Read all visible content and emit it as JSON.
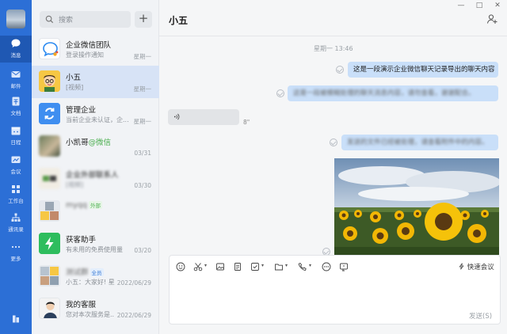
{
  "rail": {
    "items": [
      {
        "label": "消息",
        "icon": "chat-bubble-icon",
        "active": true
      },
      {
        "label": "邮件",
        "icon": "mail-icon"
      },
      {
        "label": "文档",
        "icon": "document-icon"
      },
      {
        "label": "日程",
        "icon": "calendar-icon"
      },
      {
        "label": "会议",
        "icon": "meeting-icon"
      },
      {
        "label": "工作台",
        "icon": "workbench-grid-icon"
      },
      {
        "label": "通讯录",
        "icon": "contacts-icon"
      },
      {
        "label": "更多",
        "icon": "more-dots-icon"
      }
    ],
    "bottom_icon": "bookmark-icon",
    "accent": "#2c6fd6"
  },
  "list": {
    "search_placeholder": "搜索",
    "plus_label": "+",
    "conversations": [
      {
        "name": "企业微信团队",
        "preview": "登录操作通知",
        "time": "星期一"
      },
      {
        "name": "小五",
        "preview": "[视频]",
        "time": "星期一",
        "active": true
      },
      {
        "name": "管理企业",
        "preview": "当前企业未认证，企...",
        "time": "星期一"
      },
      {
        "name": "小凯哥",
        "name_tag": "@微信",
        "preview": "",
        "time": "03/31"
      },
      {
        "name": "企业外部联系人",
        "preview": "[视频]",
        "time": "03/30"
      },
      {
        "name": "myqq",
        "ext_tag": "外部",
        "preview": "",
        "time": ""
      },
      {
        "name": "获客助手",
        "preview": "有未用的免费使用量",
        "time": "03/20"
      },
      {
        "name": "测试群",
        "all_tag": "全员",
        "preview": "小五：大家好! 星期...",
        "time": "2022/06/29"
      },
      {
        "name": "我的客服",
        "preview": "您对本次服务是...",
        "time": "2022/06/29"
      }
    ]
  },
  "chat": {
    "title": "小五",
    "window_controls": [
      "—",
      "□",
      "✕"
    ],
    "timestamp": "星期一 13:46",
    "messages": [
      {
        "side": "right",
        "text": "这是一段演示企业微信聊天记录导出的聊天内容"
      },
      {
        "side": "right",
        "text": "这是一段被模糊处理的聊天消息内容，请勿查看，谢谢配合。"
      },
      {
        "side": "left",
        "type": "voice",
        "icon": "voice-wave-icon",
        "duration": "8\""
      },
      {
        "side": "right",
        "text": "发送的文件已经被处理，请查看附件中的内容。"
      },
      {
        "side": "right",
        "type": "image",
        "subject": "sunflower-field-photo"
      }
    ],
    "toolbar": {
      "icons": [
        "emoji-icon",
        "scissors-icon",
        "image-icon",
        "file-icon",
        "todo-check-icon",
        "folder-icon",
        "phone-icon",
        "more-icon",
        "screen-capture-icon"
      ],
      "quick_meet": "快速会议"
    },
    "send_label": "发送(S)"
  }
}
